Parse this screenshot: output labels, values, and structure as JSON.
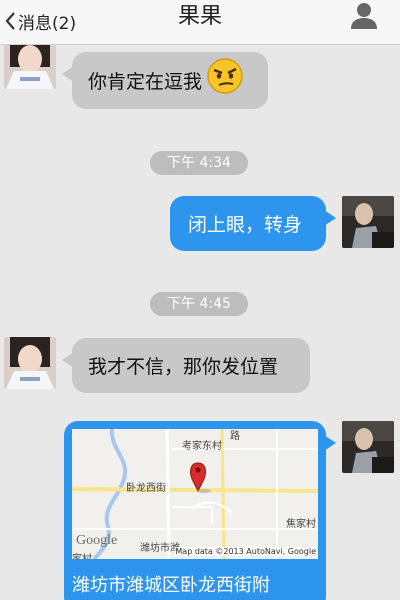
{
  "header": {
    "back_label": "消息(2)",
    "title": "果果",
    "profile_icon": "person-icon"
  },
  "messages": [
    {
      "type": "incoming",
      "text": "你肯定在逗我",
      "emoji": "smirk-face-icon"
    },
    {
      "type": "time",
      "text": "下午 4:34"
    },
    {
      "type": "outgoing",
      "text": "闭上眼，转身"
    },
    {
      "type": "time",
      "text": "下午 4:45"
    },
    {
      "type": "incoming",
      "text": "我才不信，那你发位置"
    },
    {
      "type": "location",
      "caption": "潍坊市潍城区卧龙西街附",
      "map": {
        "labels": [
          "路",
          "考家东村",
          "卧龙西街",
          "焦家村",
          "潍坊市潍",
          "家村"
        ],
        "logo": "Google",
        "attribution": "Map data ©2013 AutoNavi, Google"
      }
    }
  ],
  "colors": {
    "outgoing_bubble": "#2d95ee",
    "incoming_bubble": "#c8c8c8",
    "background": "#e8e8e8"
  }
}
